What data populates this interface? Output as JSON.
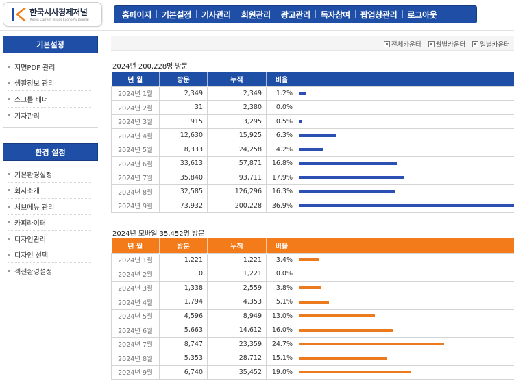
{
  "header": {
    "logo_title": "한국시사경제저널",
    "logo_subtitle": "Korea Current Issues Economy Journal",
    "nav": [
      "홈페이지",
      "기본설정",
      "기사관리",
      "회원관리",
      "광고관리",
      "독자참여",
      "팝업창관리",
      "로그아웃"
    ]
  },
  "sidebar": {
    "sections": [
      {
        "title": "기본설정",
        "items": [
          "지면PDF 관리",
          "생활정보 관리",
          "스크롤 베너",
          "기자관리"
        ]
      },
      {
        "title": "환경 설정",
        "items": [
          "기본환경설정",
          "회사소개",
          "서브메뉴 관리",
          "카피라이터",
          "디자인관리",
          "디자인 선택",
          "섹션환경설정"
        ]
      }
    ]
  },
  "counters": [
    "전체카운터",
    "월별카운터",
    "일별카운터"
  ],
  "colors": {
    "nav_blue": "#1f4ea6",
    "bar_blue": "#2b4fb3",
    "header_orange": "#f47b1a"
  },
  "tables": [
    {
      "title": "2024년 200,228명 방문",
      "headers": [
        "년 월",
        "방문",
        "누적",
        "비율",
        ""
      ],
      "rows": [
        {
          "month": "2024년 1월",
          "visits": "2,349",
          "cumulative": "2,349",
          "ratio": "1.2%",
          "pct": 1.2
        },
        {
          "month": "2024년 2월",
          "visits": "31",
          "cumulative": "2,380",
          "ratio": "0.0%",
          "pct": 0.0
        },
        {
          "month": "2024년 3월",
          "visits": "915",
          "cumulative": "3,295",
          "ratio": "0.5%",
          "pct": 0.5
        },
        {
          "month": "2024년 4월",
          "visits": "12,630",
          "cumulative": "15,925",
          "ratio": "6.3%",
          "pct": 6.3
        },
        {
          "month": "2024년 5월",
          "visits": "8,333",
          "cumulative": "24,258",
          "ratio": "4.2%",
          "pct": 4.2
        },
        {
          "month": "2024년 6월",
          "visits": "33,613",
          "cumulative": "57,871",
          "ratio": "16.8%",
          "pct": 16.8
        },
        {
          "month": "2024년 7월",
          "visits": "35,840",
          "cumulative": "93,711",
          "ratio": "17.9%",
          "pct": 17.9
        },
        {
          "month": "2024년 8월",
          "visits": "32,585",
          "cumulative": "126,296",
          "ratio": "16.3%",
          "pct": 16.3
        },
        {
          "month": "2024년 9월",
          "visits": "73,932",
          "cumulative": "200,228",
          "ratio": "36.9%",
          "pct": 36.9
        }
      ]
    },
    {
      "title": "2024년 모바일 35,452명 방문",
      "headers": [
        "년 월",
        "방문",
        "누적",
        "비율",
        ""
      ],
      "rows": [
        {
          "month": "2024년 1월",
          "visits": "1,221",
          "cumulative": "1,221",
          "ratio": "3.4%",
          "pct": 3.4
        },
        {
          "month": "2024년 2월",
          "visits": "0",
          "cumulative": "1,221",
          "ratio": "0.0%",
          "pct": 0.0
        },
        {
          "month": "2024년 3월",
          "visits": "1,338",
          "cumulative": "2,559",
          "ratio": "3.8%",
          "pct": 3.8
        },
        {
          "month": "2024년 4월",
          "visits": "1,794",
          "cumulative": "4,353",
          "ratio": "5.1%",
          "pct": 5.1
        },
        {
          "month": "2024년 5월",
          "visits": "4,596",
          "cumulative": "8,949",
          "ratio": "13.0%",
          "pct": 13.0
        },
        {
          "month": "2024년 6월",
          "visits": "5,663",
          "cumulative": "14,612",
          "ratio": "16.0%",
          "pct": 16.0
        },
        {
          "month": "2024년 7월",
          "visits": "8,747",
          "cumulative": "23,359",
          "ratio": "24.7%",
          "pct": 24.7
        },
        {
          "month": "2024년 8월",
          "visits": "5,353",
          "cumulative": "28,712",
          "ratio": "15.1%",
          "pct": 15.1
        },
        {
          "month": "2024년 9월",
          "visits": "6,740",
          "cumulative": "35,452",
          "ratio": "19.0%",
          "pct": 19.0
        }
      ]
    }
  ]
}
